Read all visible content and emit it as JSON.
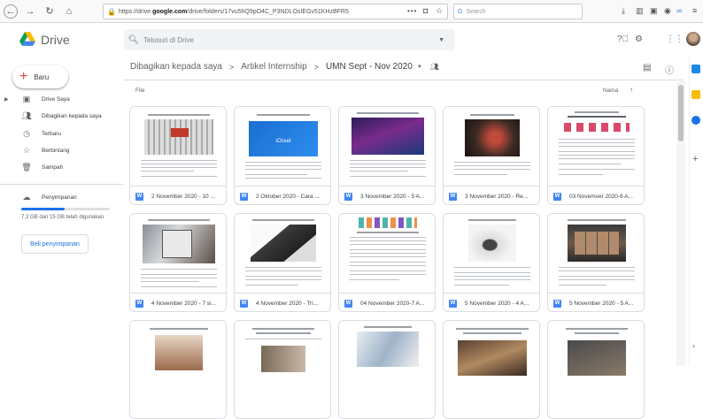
{
  "browser": {
    "url_prefix": "https://drive.",
    "url_host": "google.com",
    "url_path": "/drive/folders/17vu5hQ9pO4C_P3NDLOsIEGv51KHzBFR5",
    "search_placeholder": "Search"
  },
  "header": {
    "brand": "Drive",
    "search_placeholder": "Telusuri di Drive"
  },
  "sidebar": {
    "new_label": "Baru",
    "items": [
      {
        "label": "Drive Saya",
        "icon": "my-drive-icon"
      },
      {
        "label": "Dibagikan kepada saya",
        "icon": "shared-people-icon"
      },
      {
        "label": "Terbaru",
        "icon": "clock-icon"
      },
      {
        "label": "Berbintang",
        "icon": "star-icon"
      },
      {
        "label": "Sampah",
        "icon": "trash-icon"
      }
    ],
    "storage_label": "Penyimpanan",
    "storage_text": "7,3 GB dari 15 GB telah digunakan",
    "storage_fraction": 0.49,
    "buy_label": "Beli penyimpanan"
  },
  "breadcrumb": {
    "root": "Dibagikan kepada saya",
    "level1": "Artikel Internship",
    "current": "UMN Sept - Nov 2020"
  },
  "list": {
    "file_label": "File",
    "sort_label": "Nama",
    "files": [
      {
        "name": "2 November 2020 - 10 ...",
        "icon": "W"
      },
      {
        "name": "2 Oktober 2020 - Cara ...",
        "icon": "W"
      },
      {
        "name": "3 November 2020 - 5 A...",
        "icon": "W"
      },
      {
        "name": "3 November 2020 - Re...",
        "icon": "W"
      },
      {
        "name": "03 Novemver 2020-6 A...",
        "icon": "W"
      },
      {
        "name": "4 November 2020 - 7 si...",
        "icon": "W"
      },
      {
        "name": "4 November 2020 - Tri...",
        "icon": "W"
      },
      {
        "name": "04 November 2020-7 A...",
        "icon": "W"
      },
      {
        "name": "5 November 2020 - 4 A...",
        "icon": "W"
      },
      {
        "name": "5 November 2020 - 5 A...",
        "icon": "W"
      }
    ],
    "thumb_texts": [
      "iCloud"
    ]
  },
  "colors": {
    "accent": "#1a73e8",
    "word_blue": "#4285f4",
    "new_plus": "#ea4335"
  }
}
